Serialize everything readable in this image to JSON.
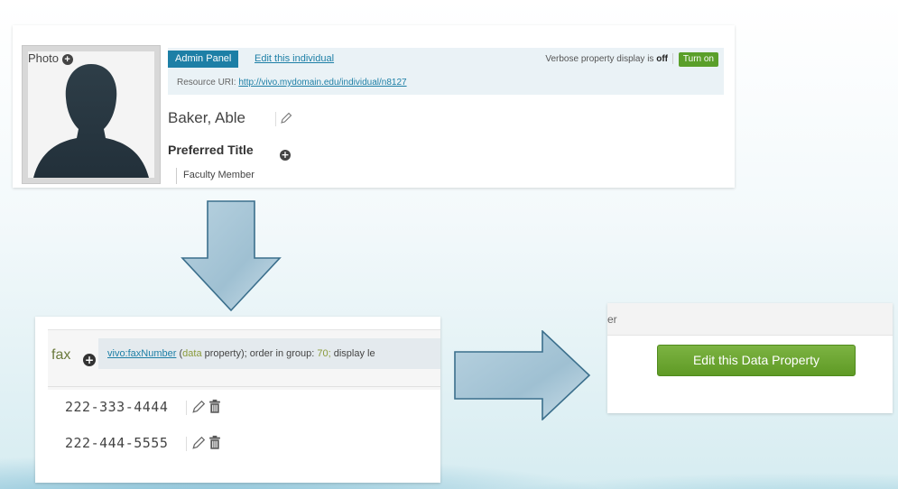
{
  "top_panel": {
    "photo_label": "Photo",
    "admin_panel_label": "Admin Panel",
    "edit_individual_link": "Edit this individual",
    "verbose_prefix": "Verbose property display is",
    "verbose_state": "off",
    "turn_on_label": "Turn on",
    "resource_uri_label": "Resource URI:",
    "resource_uri": "http://vivo.mydomain.edu/individual/n8127",
    "person_name": "Baker, Able",
    "preferred_title_label": "Preferred Title",
    "preferred_title_value": "Faculty Member"
  },
  "fax_panel": {
    "property_label": "fax",
    "property_link": "vivo:faxNumber",
    "data_word": "data",
    "property_suffix": " property); order in group: ",
    "order_value": "70;",
    "display_suffix": " display le",
    "values": [
      "222-333-4444",
      "222-444-5555"
    ]
  },
  "edit_panel": {
    "header_fragment": "er",
    "button_label": "Edit this Data Property"
  },
  "colors": {
    "admin_blue": "#1d7fa6",
    "turn_on_green": "#5a9f2a",
    "edit_button_green": "#6aa82f",
    "arrow_fill": "#aac8d8"
  }
}
